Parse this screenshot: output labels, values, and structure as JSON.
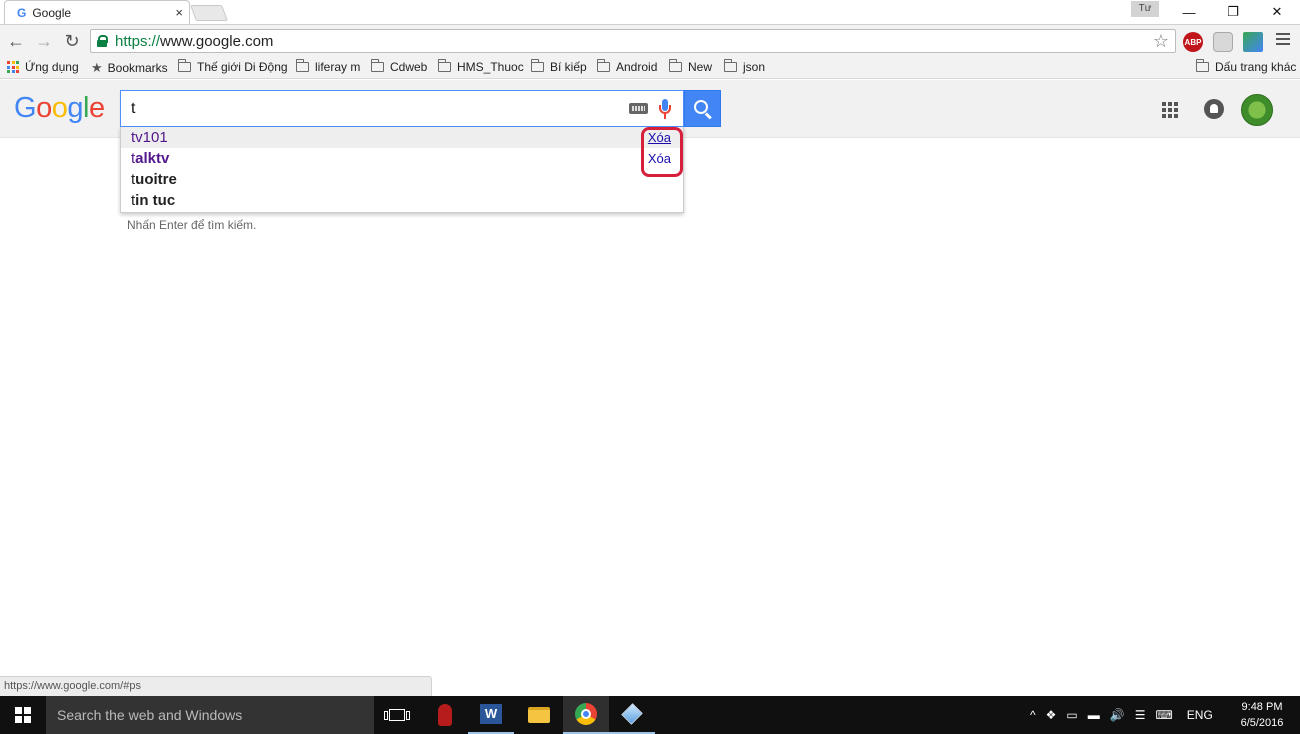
{
  "tab": {
    "title": "Google",
    "favicon": "G",
    "close": "×"
  },
  "window": {
    "user_label": "Tư",
    "minimize": "—",
    "restore": "❐",
    "close": "✕"
  },
  "toolbar": {
    "back": "←",
    "forward": "→",
    "reload": "↻",
    "url_scheme": "https://",
    "url_rest": "www.google.com",
    "star": "☆",
    "ext_abp": "ABP"
  },
  "bookmarks": {
    "items": [
      "Ứng dụng",
      "Bookmarks",
      "Thế giới Di Động",
      "liferay m",
      "Cdweb",
      "HMS_Thuoc",
      "Bí kiếp",
      "Android",
      "New",
      "json"
    ],
    "other": "Dấu trang khác"
  },
  "google": {
    "logo_letters": [
      "G",
      "o",
      "o",
      "g",
      "l",
      "e"
    ],
    "logo_colors": [
      "#4285f4",
      "#ea4335",
      "#fbbc05",
      "#4285f4",
      "#34a853",
      "#ea4335"
    ],
    "query": "t",
    "hint": "Nhấn Enter để tìm kiếm."
  },
  "suggestions": [
    {
      "prefix": "t",
      "rest": "v101",
      "remove": "Xóa"
    },
    {
      "prefix": "t",
      "rest": "alktv",
      "remove": "Xóa"
    },
    {
      "prefix": "t",
      "rest": "uoitre"
    },
    {
      "prefix": "t",
      "rest": "in tuc"
    }
  ],
  "status_url": "https://www.google.com/#ps",
  "taskbar": {
    "search_placeholder": "Search the web and Windows",
    "lang": "ENG",
    "time": "9:48 PM",
    "date": "6/5/2016",
    "tray_up": "^",
    "volume": "🔊"
  },
  "colors": {
    "accent": "#4285f4",
    "highlight_border": "#d61f3a",
    "visited": "#52188c",
    "link": "#1a0dab"
  }
}
